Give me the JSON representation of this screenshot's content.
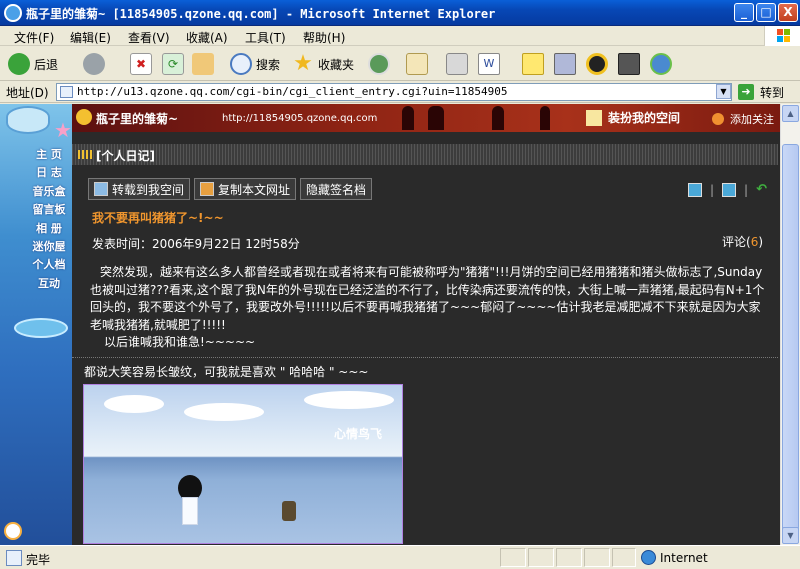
{
  "window": {
    "title": "瓶子里的雏菊~ [11854905.qzone.qq.com] - Microsoft Internet Explorer",
    "minimize_glyph": "_",
    "maximize_glyph": "□",
    "close_glyph": "X"
  },
  "menu": [
    "文件(F)",
    "编辑(E)",
    "查看(V)",
    "收藏(A)",
    "工具(T)",
    "帮助(H)"
  ],
  "toolbar": {
    "back_label": "后退",
    "search_label": "搜索",
    "favorites_label": "收藏夹"
  },
  "address": {
    "label": "地址(D)",
    "url": "http://u13.qzone.qq.com/cgi-bin/cgi_client_entry.cgi?uin=11854905",
    "go_label": "转到"
  },
  "qzone": {
    "space_title": "瓶子里的雏菊~",
    "space_url": "http://11854905.qzone.qq.com",
    "dress_label": "装扮我的空间",
    "add_follow_label": "添加关注",
    "nav": [
      "主 页",
      "日 志",
      "音乐盒",
      "留言板",
      "相 册",
      "迷你屋",
      "个人档",
      "互动"
    ],
    "section_title": "[个人日记]",
    "actions": [
      "转载到我空间",
      "复制本文网址",
      "隐藏签名档"
    ],
    "post": {
      "title": "我不要再叫猪猪了~!~~",
      "date": "发表时间：2006年9月22日  12时58分",
      "comments_label": "评论(",
      "comments_count": "6",
      "comments_close": ")",
      "paragraph1": "突然发现，越来有这么多人都曾经或者现在或者将来有可能被称呼为\"猪猪\"!!!月饼的空间已经用猪猪和猪头做标志了,Sunday也被叫过猪???看来,这个跟了我N年的外号现在已经泛滥的不行了，比传染病还要流传的快，大街上喊一声猪猪,最起码有N+1个回头的，我不要这个外号了，我要改外号!!!!!以后不要再喊我猪猪了~~~郁闷了~~~~估计我老是减肥减不下来就是因为大家老喊我猪猪,就喊肥了!!!!!",
      "paragraph2": "以后谁喊我和谁急!~~~~~"
    },
    "caption": "都说大笑容易长皱纹，可我就是喜欢 \" 哈哈哈 \" ~~~",
    "photo_text": "心情鸟飞"
  },
  "status": {
    "text": "完毕",
    "zone": "Internet"
  },
  "colors": {
    "accent_orange": "#f0962e",
    "xp_titlebar": "#0747b5",
    "page_background": "#2a2a2a"
  }
}
